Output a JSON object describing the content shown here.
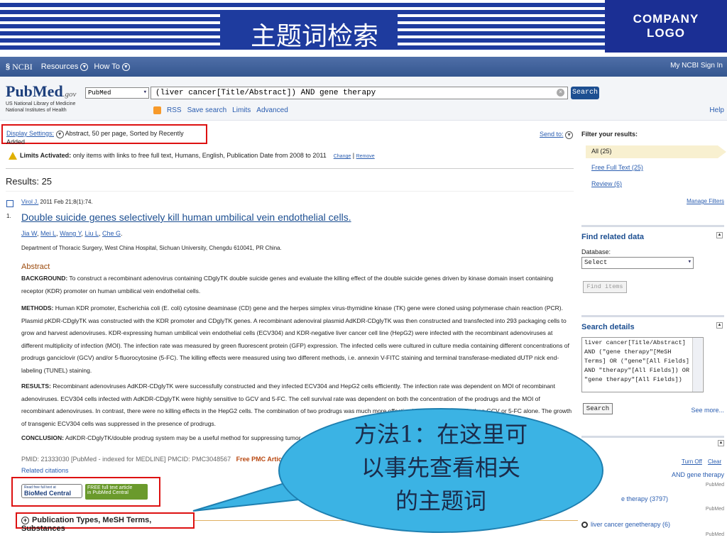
{
  "slide": {
    "title": "主题词检索",
    "logo_line1": "COMPANY",
    "logo_line2": "LOGO"
  },
  "ncbi_bar": {
    "brand": "NCBI",
    "resources": "Resources",
    "howto": "How To",
    "my_ncbi": "My NCBI",
    "sign_in": "Sign In"
  },
  "pubmed_header": {
    "logo": "PubMed",
    "logo_suffix": ".gov",
    "sub1": "US National Library of Medicine",
    "sub2": "National Institutes of Health",
    "db_value": "PubMed",
    "query": "(liver cancer[Title/Abstract]) AND gene therapy",
    "search_label": "Search",
    "links": [
      "RSS",
      "Save search",
      "Limits",
      "Advanced"
    ],
    "help": "Help"
  },
  "main": {
    "display_settings_label": "Display Settings:",
    "display_settings_value": "Abstract, 50 per page, Sorted by Recently Added",
    "send_to": "Send to:",
    "limits_label": "Limits Activated:",
    "limits_text": "only items with links to free full text, Humans, English, Publication Date from 2008 to 2011",
    "limits_change": "Change",
    "limits_remove": "Remove",
    "results": "Results: 25",
    "item_number": "1.",
    "journal": "Virol J.",
    "journal_date": "2011 Feb 21;8(1):74.",
    "article_title": "Double suicide genes selectively kill human umbilical vein endothelial cells.",
    "authors": [
      "Jia W",
      "Mei L",
      "Wang Y",
      "Liu L",
      "Che G"
    ],
    "affiliation": "Department of Thoracic Surgery, West China Hospital, Sichuan University, Chengdu 610041, PR China.",
    "abstract_label": "Abstract",
    "background_label": "BACKGROUND:",
    "background_text": "To construct a recombinant adenovirus containing CDglyTK double suicide genes and evaluate the killing effect of the double suicide genes driven by kinase domain insert containing receptor (KDR) promoter on human umbilical vein endothelial cells.",
    "methods_label": "METHODS:",
    "methods_text": "Human KDR promoter, Escherichia coli (E. coli) cytosine deaminase (CD) gene and the herpes simplex virus-thymidine kinase (TK) gene were cloned using polymerase chain reaction (PCR). Plasmid pKDR-CDglyTK was constructed with the KDR promoter and CDglyTK genes. A recombinant adenoviral plasmid AdKDR-CDglyTK was then constructed and transfected into 293 packaging cells to grow and harvest adenoviruses. KDR-expressing human umbilical vein endothelial cells (ECV304) and KDR-negative liver cancer cell line (HepG2) were infected with the recombinant adenoviruses at different multiplicity of infection (MOI). The infection rate was measured by green fluorescent protein (GFP) expression. The infected cells were cultured in culture media containing different concentrations of prodrugs ganciclovir (GCV) and/or 5-fluorocytosine (5-FC). The killing effects were measured using two different methods, i.e. annexin V-FITC staining and terminal transferase-mediated dUTP nick end-labeling (TUNEL) staining.",
    "results_label": "RESULTS:",
    "results_text": "Recombinant adenoviruses AdKDR-CDglyTK were successfully constructed and they infected ECV304 and HepG2 cells efficiently. The infection rate was dependent on MOI of recombinant adenoviruses. ECV304 cells infected with AdKDR-CDglyTK were highly sensitive to GCV and 5-FC. The cell survival rate was dependent on both the concentration of the prodrugs and the MOI of recombinant adenoviruses. In contrast, there were no killing effects in the HepG2 cells. The combination of two prodrugs was much more effective in killing ECV304 cells than GCV or 5-FC alone. The growth of transgenic ECV304 cells was suppressed in the presence of prodrugs.",
    "conclusion_label": "CONCLUSION:",
    "conclusion_text": "AdKDR-CDglyTK/double prodrug system may be a useful method for suppressing tumor",
    "pmid": "PMID: 21333030 [PubMed - indexed for MEDLINE]   PMCID: PMC3048567",
    "free_pmc": "Free PMC Article",
    "related": "Related citations",
    "biomed_line1": "Read free full text at",
    "biomed_line2": "BioMed Central",
    "pmc_line1": "FREE full text article",
    "pmc_line2": "in PubMed Central",
    "pubtypes": "Publication Types, MeSH Terms, Substances"
  },
  "sidebar": {
    "filter_title": "Filter your results:",
    "filter_all": "All (25)",
    "filter_free": "Free Full Text (25)",
    "filter_review": "Review (6)",
    "manage_filters": "Manage Filters",
    "find_related": "Find related data",
    "database_label": "Database:",
    "database_value": "Select",
    "find_items": "Find items",
    "search_details": "Search details",
    "details_text": "liver cancer[Title/Abstract]\nAND (\"gene therapy\"[MeSH\nTerms] OR (\"gene\"[All Fields]\nAND \"therapy\"[All Fields]) OR\n\"gene therapy\"[All Fields])",
    "details_search": "Search",
    "see_more": "See more...",
    "turn_off": "Turn Off",
    "clear": "Clear",
    "recent": [
      {
        "text": "AND gene therapy",
        "source": "PubMed"
      },
      {
        "text": "e therapy (3797)",
        "source": "PubMed"
      },
      {
        "text": "liver cancer genetherapy (6)",
        "source": "PubMed"
      }
    ]
  },
  "callout": {
    "line1": "方法1：在这里可",
    "line2": "以事先查看相关",
    "line3": "的主题词"
  },
  "colors": {
    "slide_blue": "#1e3b9e",
    "highlight_red": "#dd1111",
    "callout_blue": "#3bb3e4"
  }
}
